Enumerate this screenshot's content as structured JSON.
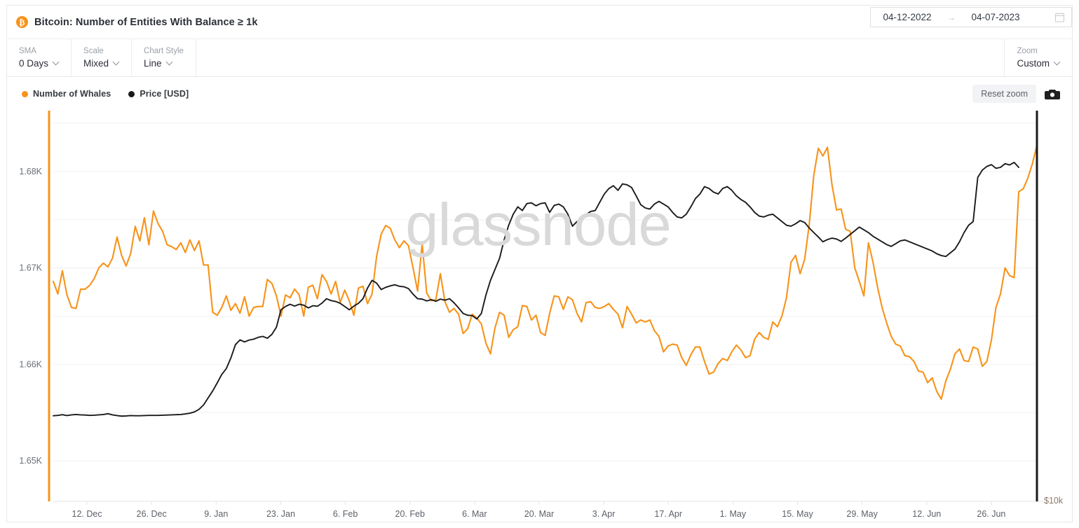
{
  "header": {
    "icon": "bitcoin-icon",
    "icon_glyph": "₿",
    "title": "Bitcoin: Number of Entities With Balance ≥ 1k",
    "accent_color": "#f7931a"
  },
  "date_range": {
    "from": "04-12-2022",
    "to": "04-07-2023",
    "arrow": "→",
    "calendar_icon": "calendar-icon"
  },
  "toolbar": {
    "controls": [
      {
        "label": "SMA",
        "value": "0 Days"
      },
      {
        "label": "Scale",
        "value": "Mixed"
      },
      {
        "label": "Chart Style",
        "value": "Line"
      }
    ],
    "zoom": {
      "label": "Zoom",
      "value": "Custom"
    }
  },
  "legend": {
    "series": [
      {
        "name": "Number of Whales",
        "color": "#f7931a"
      },
      {
        "name": "Price [USD]",
        "color": "#1a1a1a"
      }
    ],
    "reset_zoom_label": "Reset zoom",
    "camera_icon": "camera-icon"
  },
  "chart_data": {
    "type": "line",
    "title": "Bitcoin: Number of Entities With Balance ≥ 1k",
    "xlabel": "",
    "ylabel": "",
    "grid": true,
    "legend_position": "top-left",
    "watermark": "glassnode",
    "x_ticks": [
      "12. Dec",
      "26. Dec",
      "9. Jan",
      "23. Jan",
      "6. Feb",
      "20. Feb",
      "6. Mar",
      "20. Mar",
      "3. Apr",
      "17. Apr",
      "1. May",
      "15. May",
      "29. May",
      "12. Jun",
      "26. Jun"
    ],
    "y_left": {
      "ticks": [
        "1.65K",
        "1.66K",
        "1.67K",
        "1.68K"
      ],
      "values": [
        1650,
        1660,
        1670,
        1680
      ],
      "color": "#f7931a",
      "lim": [
        1645.8,
        1686.3
      ]
    },
    "y_right": {
      "ticks": [
        "$10k"
      ],
      "values": [
        10000
      ],
      "color": "#1a1a1a"
    },
    "series": [
      {
        "name": "Number of Whales",
        "color": "#f7931a",
        "axis": "left",
        "values": [
          1668.6,
          1667.3,
          1669.7,
          1667.2,
          1665.9,
          1665.8,
          1667.8,
          1667.8,
          1668.2,
          1668.9,
          1670.0,
          1670.5,
          1670.1,
          1671.0,
          1673.2,
          1671.3,
          1670.2,
          1671.5,
          1674.3,
          1672.8,
          1675.2,
          1672.4,
          1675.9,
          1674.6,
          1673.8,
          1672.4,
          1672.2,
          1671.9,
          1672.6,
          1671.6,
          1672.9,
          1671.8,
          1672.8,
          1670.3,
          1670.3,
          1665.4,
          1665.1,
          1665.9,
          1667.1,
          1665.6,
          1666.3,
          1665.3,
          1667.0,
          1665.0,
          1665.9,
          1666.0,
          1666.0,
          1668.8,
          1668.4,
          1667.1,
          1665.0,
          1667.2,
          1666.9,
          1667.8,
          1667.2,
          1665.0,
          1668.0,
          1668.2,
          1666.8,
          1669.3,
          1668.6,
          1667.3,
          1668.6,
          1666.4,
          1667.7,
          1666.6,
          1665.1,
          1667.9,
          1668.1,
          1666.3,
          1667.3,
          1671.2,
          1673.5,
          1674.4,
          1674.1,
          1672.9,
          1672.1,
          1672.8,
          1672.3,
          1670.0,
          1667.6,
          1672.5,
          1667.4,
          1666.6,
          1666.7,
          1669.4,
          1666.5,
          1665.4,
          1665.8,
          1665.2,
          1663.2,
          1663.7,
          1665.2,
          1664.8,
          1664.2,
          1662.2,
          1661.1,
          1663.8,
          1665.4,
          1665.1,
          1662.8,
          1663.6,
          1663.9,
          1666.1,
          1666.0,
          1664.6,
          1665.1,
          1663.3,
          1663.0,
          1665.3,
          1667.1,
          1667.0,
          1665.7,
          1667.0,
          1666.7,
          1665.3,
          1664.4,
          1666.4,
          1666.5,
          1665.9,
          1665.8,
          1666.0,
          1666.3,
          1665.7,
          1665.2,
          1663.8,
          1666.0,
          1665.2,
          1664.3,
          1664.6,
          1664.4,
          1664.6,
          1663.5,
          1662.9,
          1661.3,
          1661.9,
          1662.1,
          1662.0,
          1660.7,
          1659.9,
          1661.0,
          1661.8,
          1661.8,
          1660.3,
          1659.0,
          1659.2,
          1660.1,
          1660.6,
          1660.4,
          1661.3,
          1662.0,
          1661.5,
          1660.7,
          1660.9,
          1662.6,
          1663.3,
          1662.8,
          1662.6,
          1664.4,
          1663.9,
          1665.0,
          1666.9,
          1670.6,
          1671.3,
          1669.4,
          1670.9,
          1674.5,
          1679.6,
          1682.4,
          1681.6,
          1682.5,
          1678.6,
          1676.0,
          1676.1,
          1674.0,
          1673.8,
          1670.0,
          1668.6,
          1667.1,
          1672.6,
          1670.6,
          1668.0,
          1665.9,
          1664.3,
          1662.9,
          1662.1,
          1661.9,
          1660.9,
          1660.8,
          1660.3,
          1659.3,
          1659.2,
          1658.1,
          1658.6,
          1657.2,
          1656.4,
          1658.3,
          1659.5,
          1661.1,
          1661.6,
          1660.4,
          1660.3,
          1661.8,
          1661.6,
          1659.8,
          1660.3,
          1662.5,
          1665.9,
          1667.3,
          1670.0,
          1669.2,
          1669.0,
          1677.9,
          1678.2,
          1679.3,
          1680.8,
          1682.7
        ]
      },
      {
        "name": "Price [USD]",
        "color": "#1a1a1a",
        "axis": "right",
        "values": [
          16830,
          16850,
          16890,
          16840,
          16880,
          16900,
          16880,
          16870,
          16850,
          16860,
          16880,
          16900,
          16940,
          16880,
          16840,
          16810,
          16820,
          16840,
          16830,
          16830,
          16840,
          16850,
          16850,
          16850,
          16860,
          16870,
          16880,
          16890,
          16900,
          16930,
          16970,
          17040,
          17180,
          17420,
          17800,
          18180,
          18620,
          19080,
          19400,
          19980,
          20700,
          20960,
          20850,
          20950,
          21000,
          21100,
          21150,
          21050,
          21260,
          21650,
          22600,
          22780,
          22900,
          22800,
          22900,
          22850,
          22700,
          22820,
          22790,
          22960,
          23200,
          23100,
          23050,
          22950,
          22780,
          22600,
          22800,
          22950,
          23200,
          23780,
          24200,
          24050,
          23700,
          23820,
          23900,
          23960,
          23880,
          23850,
          23750,
          23450,
          23200,
          23180,
          23080,
          23150,
          23060,
          23180,
          23120,
          23200,
          22980,
          22700,
          22400,
          22300,
          22280,
          22100,
          22400,
          23400,
          24200,
          24800,
          25400,
          26400,
          27200,
          27800,
          28200,
          28000,
          28380,
          28420,
          28260,
          28380,
          28420,
          27900,
          28280,
          28350,
          28200,
          27800,
          27150,
          27400,
          27450,
          27780,
          27950,
          28000,
          28450,
          28900,
          29200,
          29350,
          29100,
          29450,
          29400,
          29250,
          28800,
          28320,
          28140,
          28080,
          28350,
          28500,
          28350,
          28200,
          27900,
          27650,
          27600,
          27800,
          28200,
          28650,
          28900,
          29300,
          29200,
          29000,
          28900,
          29200,
          29300,
          29100,
          28800,
          28600,
          28450,
          28200,
          27900,
          27700,
          27650,
          27750,
          27800,
          27600,
          27400,
          27200,
          27150,
          27280,
          27450,
          27350,
          27050,
          26800,
          26560,
          26300,
          26420,
          26500,
          26450,
          26320,
          26500,
          26700,
          26900,
          27100,
          26950,
          26800,
          26600,
          26450,
          26300,
          26150,
          26050,
          26200,
          26350,
          26400,
          26300,
          26200,
          26100,
          26000,
          25900,
          25800,
          25650,
          25550,
          25500,
          25700,
          25900,
          26300,
          26800,
          27200,
          27400,
          29800,
          30200,
          30400,
          30500,
          30300,
          30350,
          30550,
          30480,
          30620,
          30350
        ]
      }
    ]
  }
}
